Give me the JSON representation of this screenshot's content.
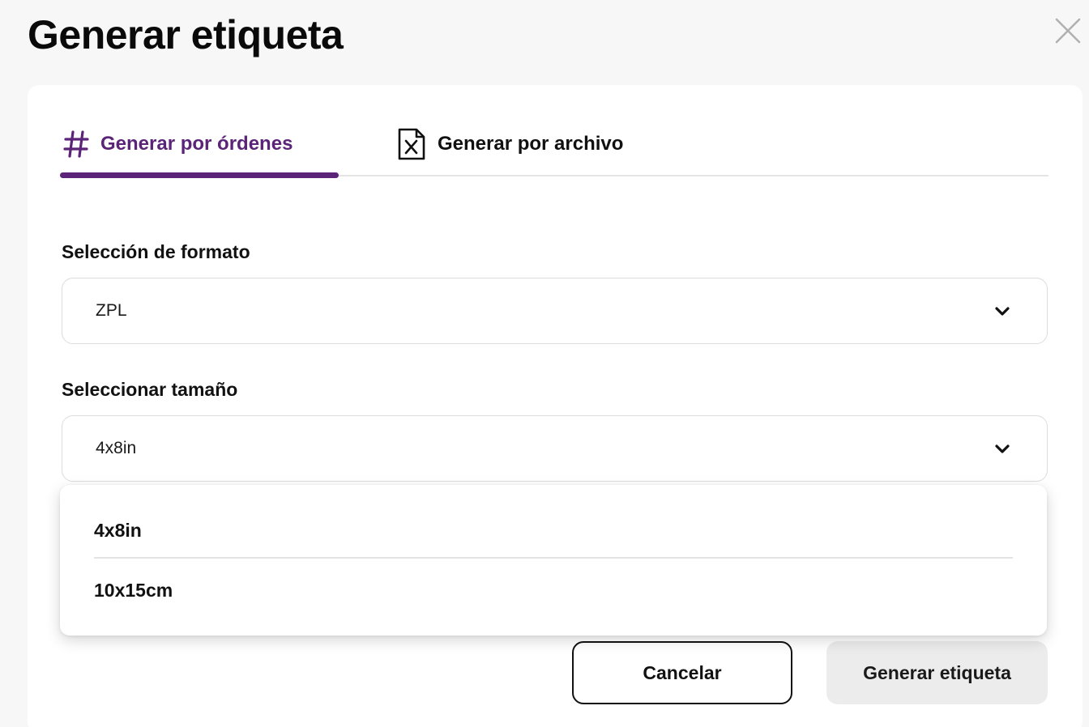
{
  "dialog": {
    "title": "Generar etiqueta",
    "close_icon": "close-icon"
  },
  "tabs": [
    {
      "label": "Generar por órdenes",
      "icon": "hash-icon",
      "active": true
    },
    {
      "label": "Generar por archivo",
      "icon": "file-excel-icon",
      "active": false
    }
  ],
  "format": {
    "label": "Selección de formato",
    "value": "ZPL"
  },
  "size": {
    "label": "Seleccionar tamaño",
    "value": "4x8in",
    "options": [
      "4x8in",
      "10x15cm"
    ]
  },
  "actions": {
    "cancel_label": "Cancelar",
    "generate_label": "Generar etiqueta"
  },
  "colors": {
    "accent": "#5b2478",
    "background": "#f7f7f7",
    "card": "#ffffff"
  }
}
